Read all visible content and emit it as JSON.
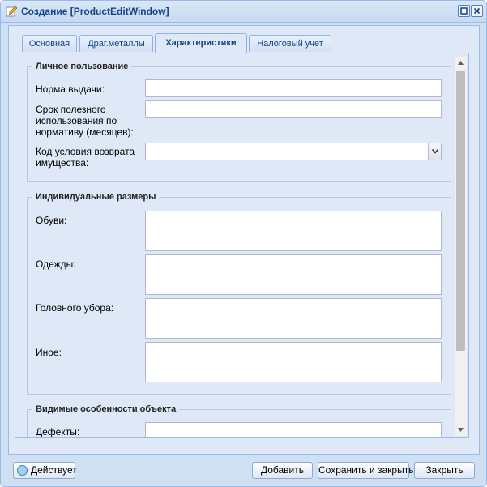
{
  "window": {
    "title": "Создание [ProductEditWindow]",
    "accent_color": "#15428b",
    "tools": [
      "maximize-icon",
      "close-icon"
    ]
  },
  "tabs": [
    {
      "label": "Основная",
      "active": false
    },
    {
      "label": "Драг.металлы",
      "active": false
    },
    {
      "label": "Характеристики",
      "active": true
    },
    {
      "label": "Налоговый учет",
      "active": false
    }
  ],
  "personal_use": {
    "legend": "Личное пользование",
    "issue_norm_label": "Норма выдачи:",
    "issue_norm_value": "",
    "useful_life_label": "Срок полезного использования по нормативу (месяцев):",
    "useful_life_value": "",
    "return_condition_label": "Код условия возврата имущества:",
    "return_condition_value": ""
  },
  "sizes": {
    "legend": "Индивидуальные размеры",
    "shoes_label": "Обуви:",
    "shoes_value": "",
    "clothes_label": "Одежды:",
    "clothes_value": "",
    "headwear_label": "Головного убора:",
    "headwear_value": "",
    "other_label": "Иное:",
    "other_value": ""
  },
  "visible_features": {
    "legend": "Видимые особенности объекта",
    "defects_label": "Дефекты:",
    "defects_value": ""
  },
  "footer": {
    "status_label": "Действует",
    "add_label": "Добавить",
    "save_close_label": "Сохранить и закрыть",
    "close_label": "Закрыть"
  }
}
